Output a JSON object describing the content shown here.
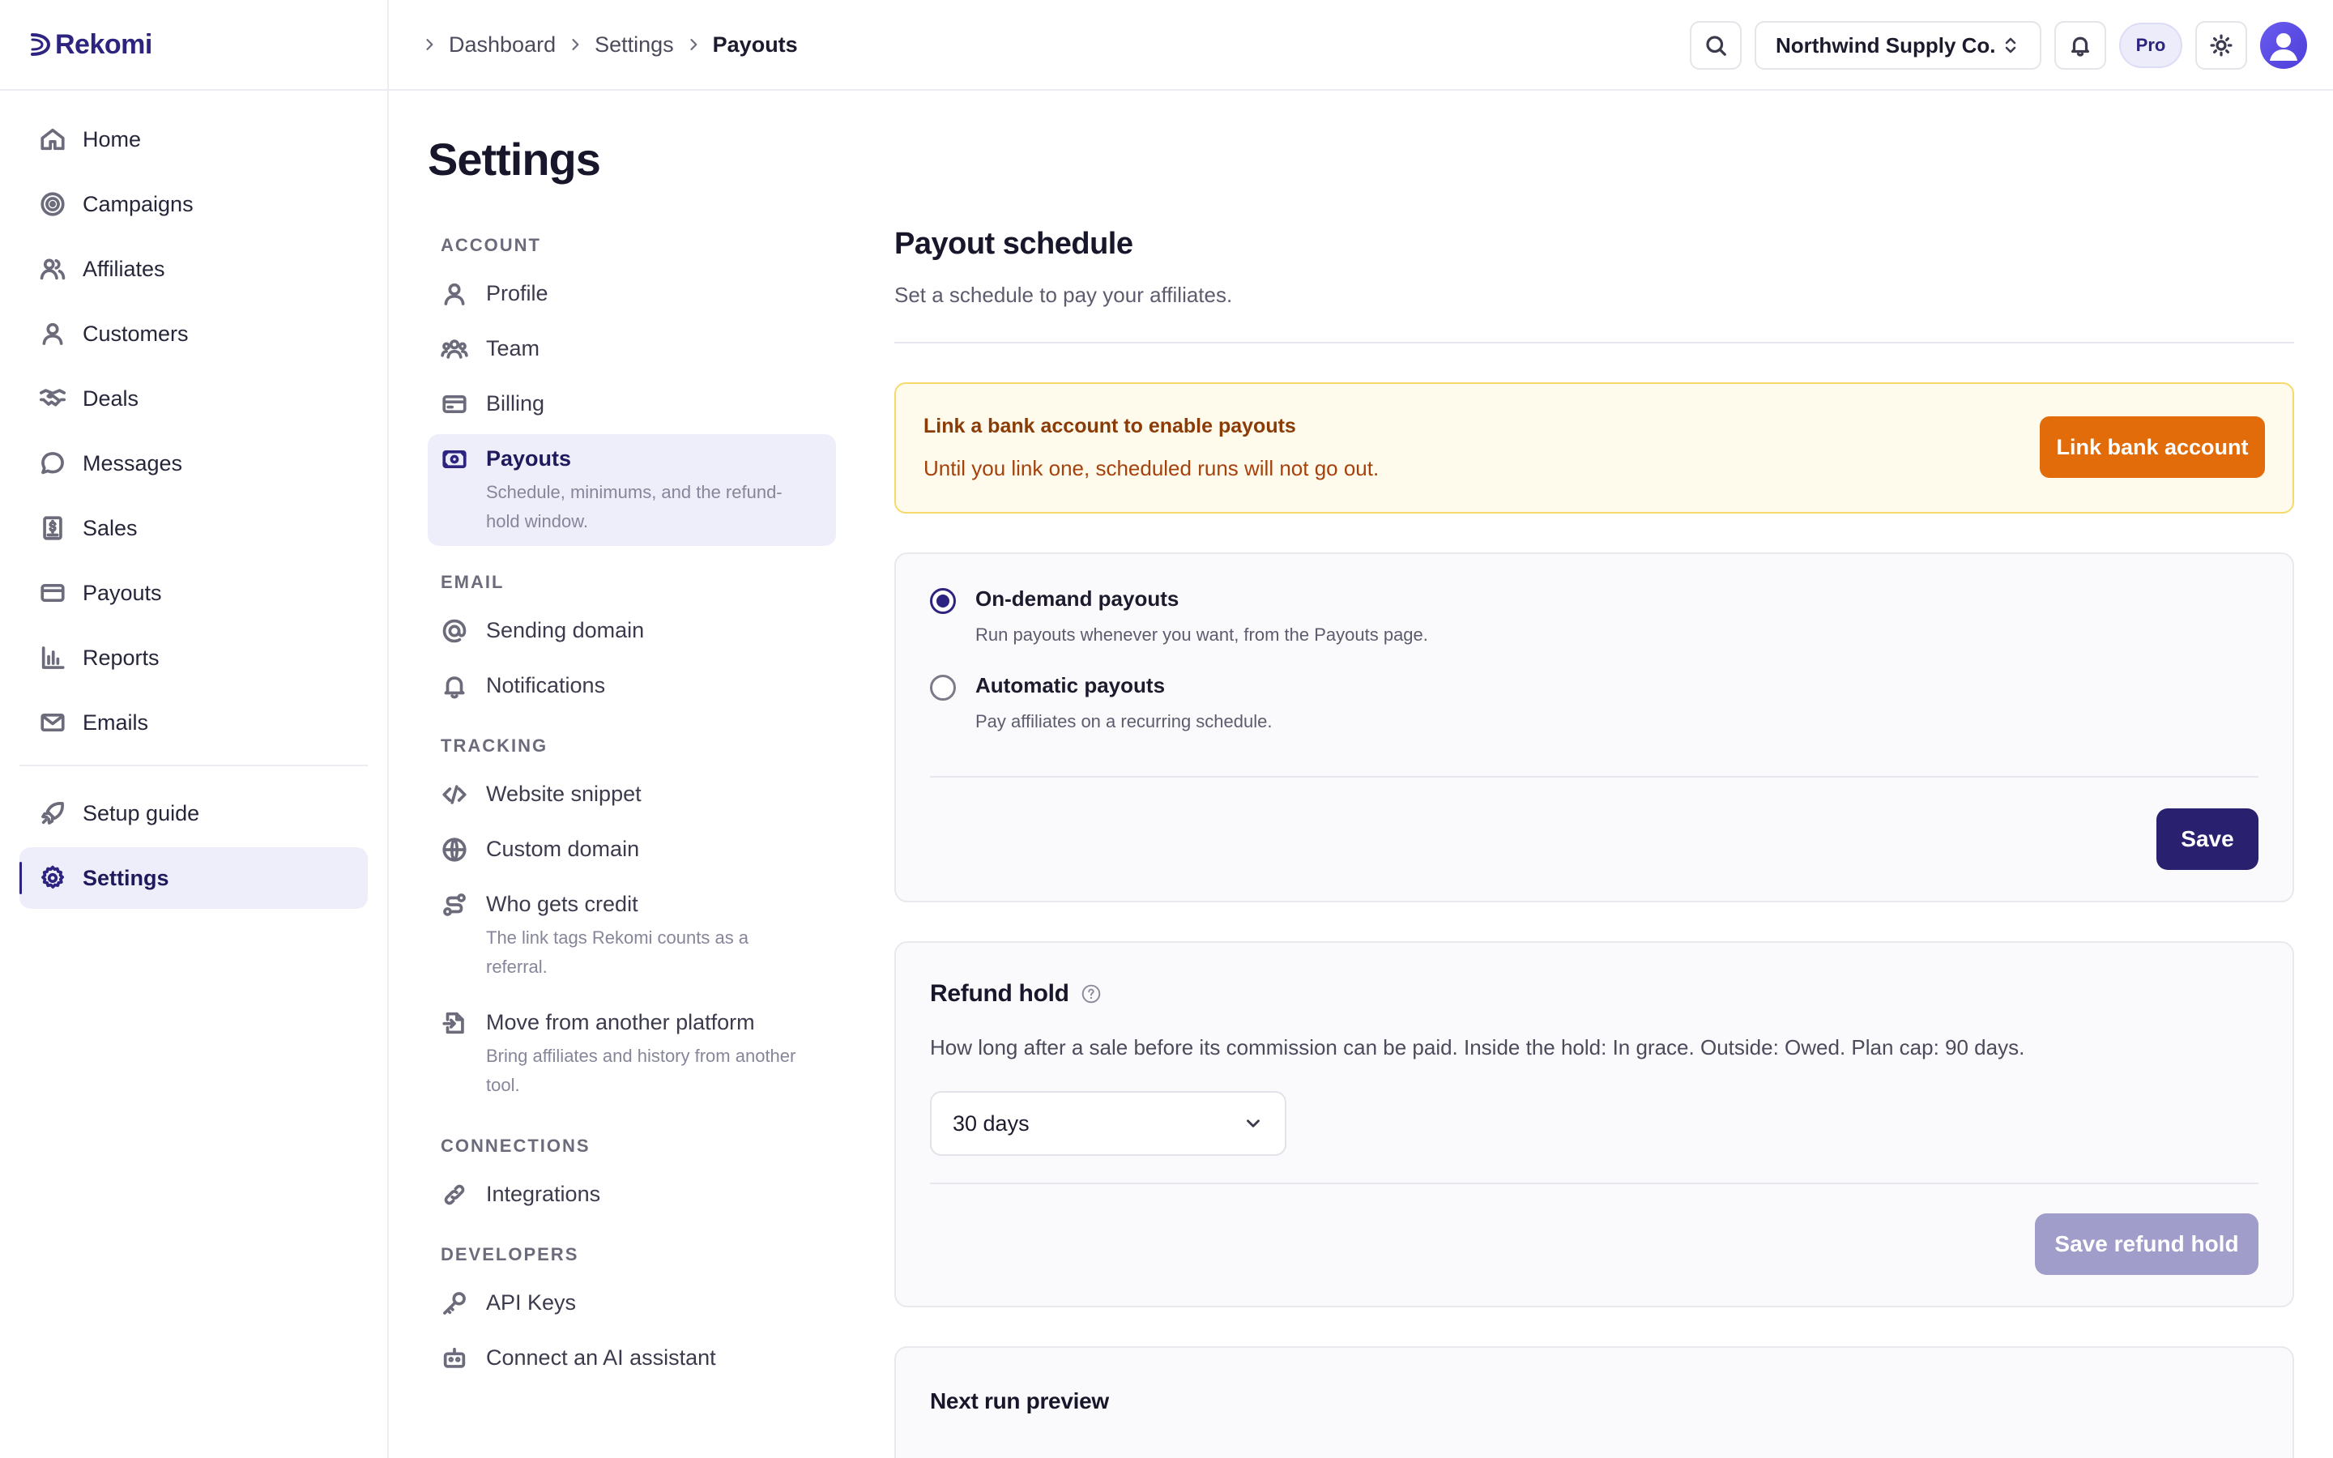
{
  "app": {
    "brand": "Rekomi"
  },
  "sidebar": {
    "items": [
      {
        "label": "Home",
        "icon": "home-icon"
      },
      {
        "label": "Campaigns",
        "icon": "target-icon"
      },
      {
        "label": "Affiliates",
        "icon": "users-icon"
      },
      {
        "label": "Customers",
        "icon": "user-icon"
      },
      {
        "label": "Deals",
        "icon": "handshake-icon"
      },
      {
        "label": "Messages",
        "icon": "chat-icon"
      },
      {
        "label": "Sales",
        "icon": "receipt-icon"
      },
      {
        "label": "Payouts",
        "icon": "card-icon"
      },
      {
        "label": "Reports",
        "icon": "bar-chart-icon"
      },
      {
        "label": "Emails",
        "icon": "mail-icon"
      }
    ],
    "footer_items": [
      {
        "label": "Setup guide",
        "icon": "rocket-icon"
      },
      {
        "label": "Settings",
        "icon": "gear-icon",
        "active": true
      }
    ]
  },
  "topbar": {
    "breadcrumb": [
      "Dashboard",
      "Settings",
      "Payouts"
    ],
    "org_name": "Northwind Supply Co.",
    "plan_badge": "Pro"
  },
  "page": {
    "title": "Settings"
  },
  "settings_nav": {
    "account": {
      "heading": "ACCOUNT",
      "items": [
        {
          "label": "Profile"
        },
        {
          "label": "Team"
        },
        {
          "label": "Billing"
        },
        {
          "label": "Payouts",
          "desc": "Schedule, minimums, and the refund-hold window.",
          "active": true
        }
      ]
    },
    "email": {
      "heading": "EMAIL",
      "items": [
        {
          "label": "Sending domain"
        },
        {
          "label": "Notifications"
        }
      ]
    },
    "tracking": {
      "heading": "TRACKING",
      "items": [
        {
          "label": "Website snippet"
        },
        {
          "label": "Custom domain"
        },
        {
          "label": "Who gets credit",
          "desc": "The link tags Rekomi counts as a referral."
        },
        {
          "label": "Move from another platform",
          "desc": "Bring affiliates and history from another tool."
        }
      ]
    },
    "connections": {
      "heading": "CONNECTIONS",
      "items": [
        {
          "label": "Integrations"
        }
      ]
    },
    "developers": {
      "heading": "DEVELOPERS",
      "items": [
        {
          "label": "API Keys"
        },
        {
          "label": "Connect an AI assistant"
        }
      ]
    }
  },
  "payout_schedule": {
    "title": "Payout schedule",
    "subtitle": "Set a schedule to pay your affiliates.",
    "alert": {
      "title": "Link a bank account to enable payouts",
      "text": "Until you link one, scheduled runs will not go out.",
      "button": "Link bank account"
    },
    "options": [
      {
        "title": "On-demand payouts",
        "desc": "Run payouts whenever you want, from the Payouts page.",
        "checked": true
      },
      {
        "title": "Automatic payouts",
        "desc": "Pay affiliates on a recurring schedule.",
        "checked": false
      }
    ],
    "save_label": "Save"
  },
  "refund_hold": {
    "title": "Refund hold",
    "desc": "How long after a sale before its commission can be paid. Inside the hold: In grace. Outside: Owed. Plan cap: 90 days.",
    "selected": "30 days",
    "save_label": "Save refund hold"
  },
  "next_run": {
    "title": "Next run preview"
  },
  "colors": {
    "brand": "#2d2480",
    "warning_bg": "#fefaec",
    "warning_border": "#f6d96c",
    "warning_button": "#e26c0a",
    "active_bg": "#eeeefb"
  }
}
